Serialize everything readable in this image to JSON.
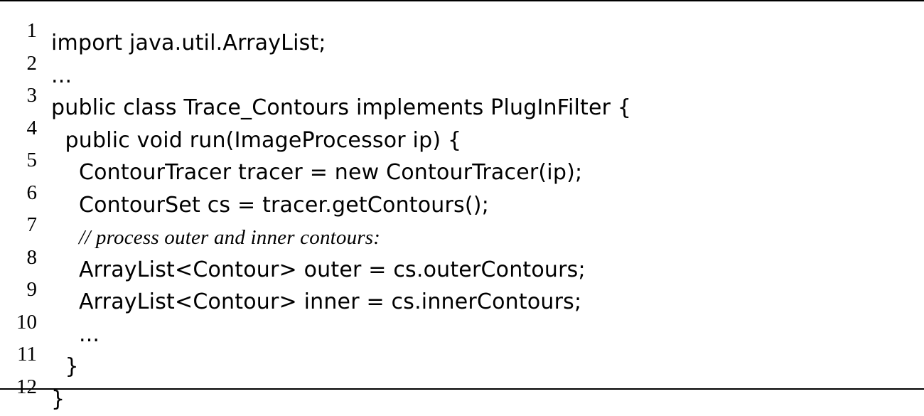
{
  "listing": {
    "lines": [
      {
        "no": "1",
        "indent": "",
        "text": "import java.util.ArrayList;",
        "comment": false
      },
      {
        "no": "2",
        "indent": "",
        "text": "...",
        "comment": false
      },
      {
        "no": "3",
        "indent": "",
        "text": "public class Trace_Contours implements PlugInFilter {",
        "comment": false
      },
      {
        "no": "4",
        "indent": "  ",
        "text": "public void run(ImageProcessor ip) {",
        "comment": false
      },
      {
        "no": "5",
        "indent": "    ",
        "text": "ContourTracer tracer = new ContourTracer(ip);",
        "comment": false
      },
      {
        "no": "6",
        "indent": "    ",
        "text": "ContourSet cs = tracer.getContours();",
        "comment": false
      },
      {
        "no": "7",
        "indent": "    ",
        "text": "// process outer and inner contours:",
        "comment": true
      },
      {
        "no": "8",
        "indent": "    ",
        "text": "ArrayList<Contour> outer = cs.outerContours;",
        "comment": false
      },
      {
        "no": "9",
        "indent": "    ",
        "text": "ArrayList<Contour> inner = cs.innerContours;",
        "comment": false
      },
      {
        "no": "10",
        "indent": "    ",
        "text": "...",
        "comment": false
      },
      {
        "no": "11",
        "indent": "  ",
        "text": "}",
        "comment": false
      },
      {
        "no": "12",
        "indent": "",
        "text": "}",
        "comment": false
      }
    ]
  }
}
